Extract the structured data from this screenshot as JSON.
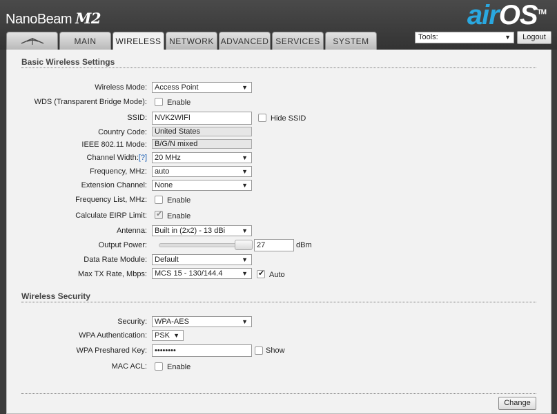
{
  "header": {
    "product_name": "NanoBeam",
    "product_model": "M2",
    "logo_air": "air",
    "logo_os": "OS",
    "logo_tm": "TM"
  },
  "tabs": [
    {
      "label": "",
      "icon": "ubiquiti-logo-icon"
    },
    {
      "label": "MAIN"
    },
    {
      "label": "WIRELESS",
      "active": true
    },
    {
      "label": "NETWORK"
    },
    {
      "label": "ADVANCED"
    },
    {
      "label": "SERVICES"
    },
    {
      "label": "SYSTEM"
    }
  ],
  "tools": {
    "value": "Tools:"
  },
  "logout_label": "Logout",
  "basic": {
    "title": "Basic Wireless Settings",
    "wireless_mode": {
      "label": "Wireless Mode:",
      "value": "Access Point"
    },
    "wds": {
      "label": "WDS (Transparent Bridge Mode):",
      "checkbox_label": "Enable",
      "checked": false
    },
    "ssid": {
      "label": "SSID:",
      "value": "NVK2WIFI",
      "hide_label": "Hide SSID",
      "hide_checked": false
    },
    "country_code": {
      "label": "Country Code:",
      "value": "United States"
    },
    "ieee_mode": {
      "label": "IEEE 802.11 Mode:",
      "value": "B/G/N mixed"
    },
    "channel_width": {
      "label": "Channel Width:",
      "help": "[?]",
      "value": "20 MHz"
    },
    "frequency": {
      "label": "Frequency, MHz:",
      "value": "auto"
    },
    "extension_channel": {
      "label": "Extension Channel:",
      "value": "None"
    },
    "frequency_list": {
      "label": "Frequency List, MHz:",
      "checkbox_label": "Enable",
      "checked": false
    },
    "eirp": {
      "label": "Calculate EIRP Limit:",
      "checkbox_label": "Enable",
      "checked": true
    },
    "antenna": {
      "label": "Antenna:",
      "value": "Built in (2x2) - 13 dBi"
    },
    "output_power": {
      "label": "Output Power:",
      "value": "27",
      "unit": "dBm",
      "slider_fraction": 0.9
    },
    "data_rate_module": {
      "label": "Data Rate Module:",
      "value": "Default"
    },
    "max_tx_rate": {
      "label": "Max TX Rate, Mbps:",
      "value": "MCS 15 - 130/144.4",
      "auto_label": "Auto",
      "auto_checked": true
    }
  },
  "security": {
    "title": "Wireless Security",
    "security": {
      "label": "Security:",
      "value": "WPA-AES"
    },
    "wpa_auth": {
      "label": "WPA Authentication:",
      "value": "PSK"
    },
    "wpa_key": {
      "label": "WPA Preshared Key:",
      "value": "••••••••",
      "show_label": "Show",
      "show_checked": false
    },
    "mac_acl": {
      "label": "MAC ACL:",
      "checkbox_label": "Enable",
      "checked": false
    }
  },
  "change_label": "Change"
}
